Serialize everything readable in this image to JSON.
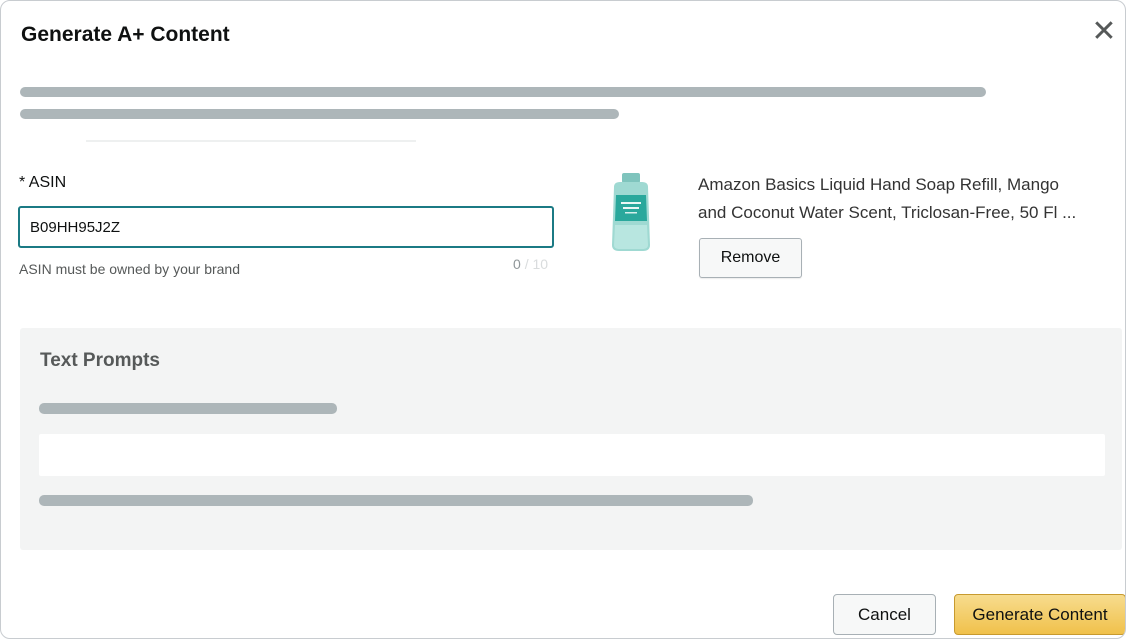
{
  "dialog": {
    "title": "Generate A+ Content",
    "close_icon": "close-icon"
  },
  "asin": {
    "label": "* ASIN",
    "value": "B09HH95J2Z",
    "helper": "ASIN must be owned by your brand",
    "count": "0",
    "count_sep": "/",
    "count_max": "10"
  },
  "product": {
    "title_line1": "Amazon Basics Liquid Hand Soap Refill, Mango",
    "title_line2": "and Coconut Water Scent, Triclosan-Free, 50 Fl ...",
    "image_icon": "soap-bottle-image",
    "remove_label": "Remove"
  },
  "text_prompts": {
    "title": "Text Prompts",
    "input_value": ""
  },
  "footer": {
    "cancel_label": "Cancel",
    "generate_label": "Generate Content"
  },
  "colors": {
    "input_focus_border": "#1b7a84",
    "primary_button": "#f0c14b",
    "skeleton": "#adb6b9",
    "panel_bg": "#f3f4f4"
  }
}
